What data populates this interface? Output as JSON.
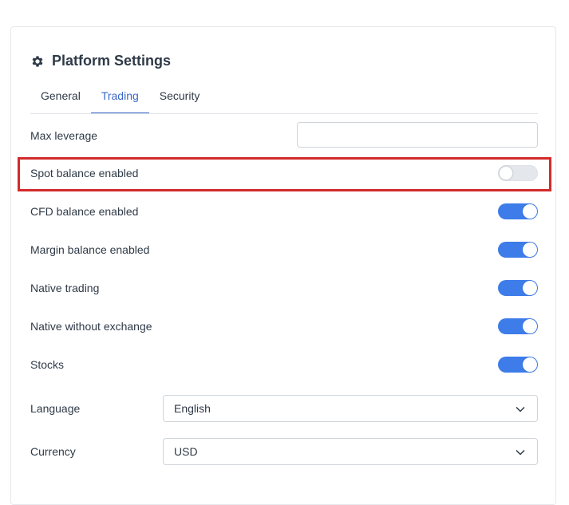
{
  "header": {
    "title": "Platform Settings",
    "icon": "gear-icon"
  },
  "tabs": [
    {
      "label": "General",
      "active": false
    },
    {
      "label": "Trading",
      "active": true
    },
    {
      "label": "Security",
      "active": false
    }
  ],
  "settings": {
    "max_leverage": {
      "label": "Max leverage",
      "value": "",
      "placeholder": ""
    },
    "toggles": [
      {
        "label": "Spot balance enabled",
        "on": false
      },
      {
        "label": "CFD balance enabled",
        "on": true
      },
      {
        "label": "Margin balance enabled",
        "on": true
      },
      {
        "label": "Native trading",
        "on": true
      },
      {
        "label": "Native without exchange",
        "on": true
      },
      {
        "label": "Stocks",
        "on": true
      }
    ],
    "language": {
      "label": "Language",
      "value": "English"
    },
    "currency": {
      "label": "Currency",
      "value": "USD"
    }
  },
  "colors": {
    "accent": "#3d7ce9",
    "tab_active": "#3a68c9",
    "highlight": "#d32a2a"
  }
}
